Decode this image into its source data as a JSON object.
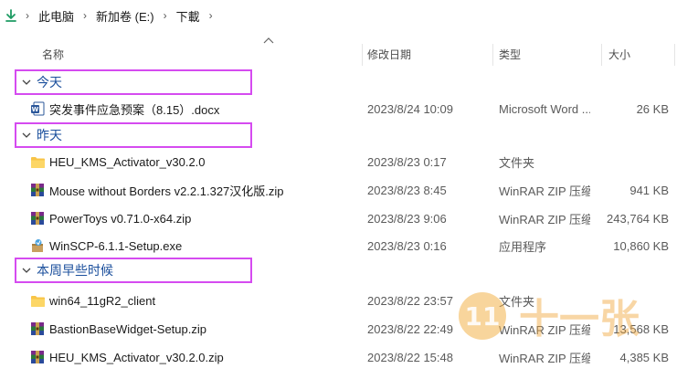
{
  "breadcrumb": {
    "items": [
      "此电脑",
      "新加卷 (E:)",
      "下載"
    ]
  },
  "columns": {
    "name": "名称",
    "date": "修改日期",
    "type": "类型",
    "size": "大小"
  },
  "groups": [
    {
      "label": "今天",
      "files": [
        {
          "icon": "word-document-icon",
          "name": "突发事件应急预案（8.15）.docx",
          "date": "2023/8/24 10:09",
          "type": "Microsoft Word ...",
          "size": "26 KB"
        }
      ]
    },
    {
      "label": "昨天",
      "files": [
        {
          "icon": "folder-icon",
          "name": "HEU_KMS_Activator_v30.2.0",
          "date": "2023/8/23 0:17",
          "type": "文件夹",
          "size": ""
        },
        {
          "icon": "winrar-archive-icon",
          "name": "Mouse without Borders v2.2.1.327汉化版.zip",
          "date": "2023/8/23 8:45",
          "type": "WinRAR ZIP 压缩...",
          "size": "941 KB"
        },
        {
          "icon": "winrar-archive-icon",
          "name": "PowerToys v0.71.0-x64.zip",
          "date": "2023/8/23 9:06",
          "type": "WinRAR ZIP 压缩...",
          "size": "243,764 KB"
        },
        {
          "icon": "installer-icon",
          "name": "WinSCP-6.1.1-Setup.exe",
          "date": "2023/8/23 0:16",
          "type": "应用程序",
          "size": "10,860 KB"
        }
      ]
    },
    {
      "label": "本周早些时候",
      "files": [
        {
          "icon": "folder-icon",
          "name": "win64_11gR2_client",
          "date": "2023/8/22 23:57",
          "type": "文件夹",
          "size": ""
        },
        {
          "icon": "winrar-archive-icon",
          "name": "BastionBaseWidget-Setup.zip",
          "date": "2023/8/22 22:49",
          "type": "WinRAR ZIP 压缩...",
          "size": "13,568 KB"
        },
        {
          "icon": "winrar-archive-icon",
          "name": "HEU_KMS_Activator_v30.2.0.zip",
          "date": "2023/8/22 15:48",
          "type": "WinRAR ZIP 压缩...",
          "size": "4,385 KB"
        }
      ]
    }
  ],
  "watermark": {
    "number": "11",
    "text": "十一张"
  },
  "colors": {
    "group_highlight": "#d54bf0",
    "group_text": "#1b4f9c",
    "folder": "#f8c447",
    "download_arrow": "#1d9b63"
  }
}
